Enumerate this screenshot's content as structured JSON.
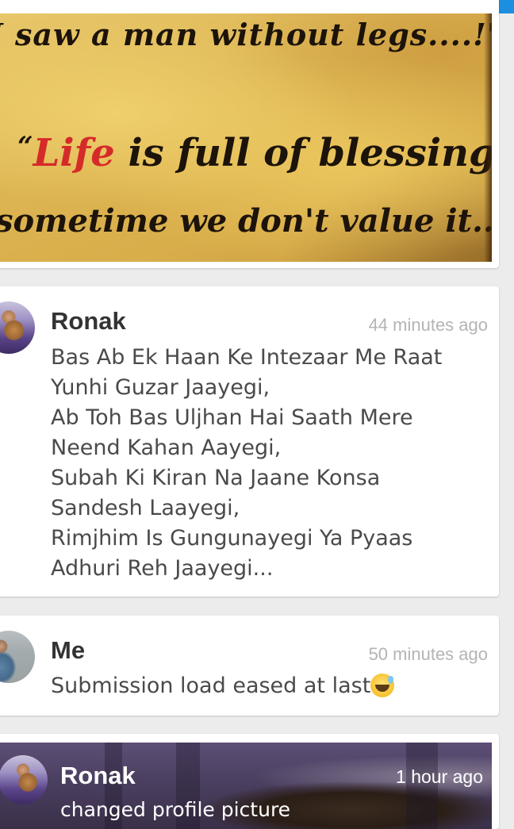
{
  "colors": {
    "status_bar": "#1d8fe1",
    "background": "#ececec",
    "card": "#ffffff",
    "name_text": "#333333",
    "time_text": "#b4b4b4",
    "body_text": "#4a4a4a",
    "quote_highlight": "#d52a2a"
  },
  "feed": {
    "image_post": {
      "quote_line_1": "I saw a man without legs....!\"",
      "quote_line_2_open": "“",
      "quote_line_2_highlight": "Life",
      "quote_line_2_rest": " is full of blessings,",
      "quote_line_3": "sometime we don't value it..",
      "quote_line_3_close": "”"
    },
    "posts": [
      {
        "author": "Ronak",
        "time": "44 minutes ago",
        "avatar": "ronak-guitar-avatar",
        "body": "Bas Ab Ek Haan Ke Intezaar Me Raat\nYunhi Guzar Jaayegi,\nAb Toh Bas Uljhan Hai Saath Mere\nNeend Kahan Aayegi,\nSubah Ki Kiran Na Jaane Konsa\nSandesh Laayegi,\nRimjhim Is Gungunayegi Ya Pyaas\nAdhuri Reh Jaayegi..."
      },
      {
        "author": "Me",
        "time": "50 minutes ago",
        "avatar": "me-avatar",
        "body": "Submission load eased at last",
        "emoji": "grinning-sweat-emoji"
      }
    ],
    "profile_picture_post": {
      "author": "Ronak",
      "time": "1 hour ago",
      "description": "changed profile picture",
      "avatar": "ronak-guitar-avatar"
    }
  }
}
